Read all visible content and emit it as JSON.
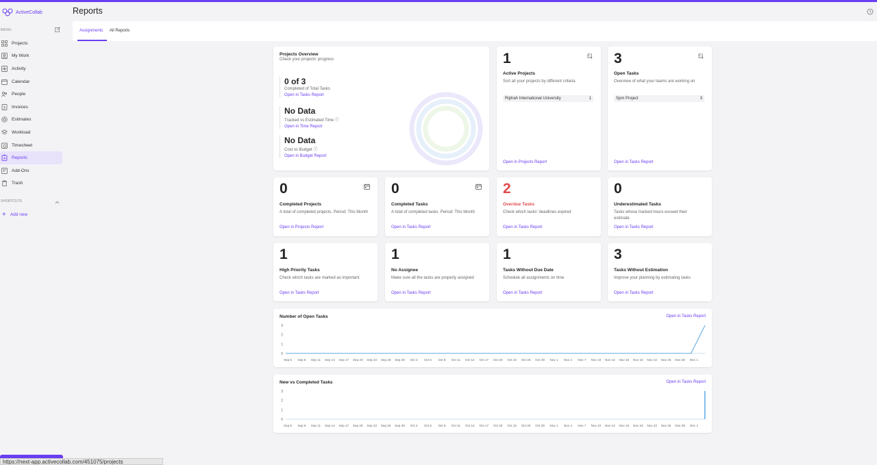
{
  "app": {
    "brand": "ActiveCollab",
    "page_title": "Reports",
    "status_url": "https://next-app.activecollab.com/451075/projects"
  },
  "sidebar": {
    "menu_label": "MENU",
    "items": [
      {
        "label": "Projects",
        "icon": "grid-icon"
      },
      {
        "label": "My Work",
        "icon": "user-square-icon"
      },
      {
        "label": "Activity",
        "icon": "activity-icon"
      },
      {
        "label": "Calendar",
        "icon": "calendar-icon"
      },
      {
        "label": "People",
        "icon": "people-icon"
      },
      {
        "label": "Invoices",
        "icon": "invoice-icon"
      },
      {
        "label": "Estimates",
        "icon": "estimate-icon"
      },
      {
        "label": "Workload",
        "icon": "workload-icon"
      },
      {
        "label": "Timesheet",
        "icon": "timesheet-icon"
      },
      {
        "label": "Reports",
        "icon": "reports-icon"
      },
      {
        "label": "Add-Ons",
        "icon": "addons-icon"
      },
      {
        "label": "Trash",
        "icon": "trash-icon"
      }
    ],
    "shortcuts_label": "SHORTCUTS",
    "add_new": "Add new"
  },
  "tabs": [
    {
      "label": "Assignments"
    },
    {
      "label": "All Reports"
    }
  ],
  "overview": {
    "title": "Projects Overview",
    "subtitle": "Check your projects' progress",
    "stats": [
      {
        "value": "0 of 3",
        "label": "Completed of Total Tasks",
        "link": "Open in Tasks Report"
      },
      {
        "value": "No Data",
        "label": "Tracked vs Estimated Time",
        "link": "Open in Time Report"
      },
      {
        "value": "No Data",
        "label": "Cost vs Budget",
        "link": "Open in Budget Report"
      }
    ]
  },
  "active_projects": {
    "value": "1",
    "title": "Active Projects",
    "desc": "Sort all your projects by different criteria",
    "row_name": "Riphah International University",
    "row_count": "1",
    "link": "Open in Projects Report"
  },
  "open_tasks": {
    "value": "3",
    "title": "Open Tasks",
    "desc": "Overview of what your teams are working on",
    "row_name": "Spm Project",
    "row_count": "3",
    "link": "Open in Tasks Report"
  },
  "cards_row2": [
    {
      "value": "0",
      "title": "Completed Projects",
      "desc": "A total of completed projects. Period: This Month",
      "link": "Open in Projects Report"
    },
    {
      "value": "0",
      "title": "Completed Tasks",
      "desc": "A total of completed tasks. Period: This Month",
      "link": "Open in Tasks Report"
    },
    {
      "value": "2",
      "title": "Overdue Tasks",
      "desc": "Check which tasks' deadlines expired",
      "link": "Open in Tasks Report"
    },
    {
      "value": "0",
      "title": "Underestimated Tasks",
      "desc": "Tasks whose tracked hours exceed their estimate",
      "link": "Open in Tasks Report"
    }
  ],
  "cards_row3": [
    {
      "value": "1",
      "title": "High Priority Tasks",
      "desc": "Check which tasks are marked as important",
      "link": "Open in Tasks Report"
    },
    {
      "value": "1",
      "title": "No Assignee",
      "desc": "Make sure all the tasks are properly assigned",
      "link": "Open in Tasks Report"
    },
    {
      "value": "1",
      "title": "Tasks Without Due Date",
      "desc": "Schedule all assignments on time",
      "link": "Open in Tasks Report"
    },
    {
      "value": "3",
      "title": "Tasks Without Estimation",
      "desc": "Improve your planning by estimating tasks",
      "link": "Open in Tasks Report"
    }
  ],
  "colors": {
    "accent": "#6a3df2",
    "danger": "#e04a4a",
    "line": "#5aa9e6"
  },
  "chart_data": [
    {
      "type": "line",
      "title": "Number of Open Tasks",
      "link": "Open in Tasks Report",
      "x": [
        "Sep 5",
        "Sep 8",
        "Sep 11",
        "Sep 14",
        "Sep 17",
        "Sep 20",
        "Sep 23",
        "Sep 26",
        "Sep 29",
        "Oct 2",
        "Oct 5",
        "Oct 8",
        "Oct 11",
        "Oct 14",
        "Oct 17",
        "Oct 20",
        "Oct 23",
        "Oct 26",
        "Oct 29",
        "Nov 1",
        "Nov 4",
        "Nov 7",
        "Nov 10",
        "Nov 13",
        "Nov 16",
        "Nov 19",
        "Nov 22",
        "Nov 25",
        "Nov 28",
        "Dec 1"
      ],
      "yticks": [
        0,
        1,
        2,
        3
      ],
      "ylim": [
        0,
        3
      ],
      "values": [
        0,
        0,
        0,
        0,
        0,
        0,
        0,
        0,
        0,
        0,
        0,
        0,
        0,
        0,
        0,
        0,
        0,
        0,
        0,
        0,
        0,
        0,
        0,
        0,
        0,
        0,
        0,
        0,
        0,
        0,
        3
      ]
    },
    {
      "type": "bar",
      "title": "New vs Completed Tasks",
      "link": "Open in Tasks Report",
      "x": [
        "Sep 5",
        "Sep 8",
        "Sep 11",
        "Sep 14",
        "Sep 17",
        "Sep 20",
        "Sep 23",
        "Sep 26",
        "Sep 29",
        "Oct 2",
        "Oct 5",
        "Oct 8",
        "Oct 11",
        "Oct 14",
        "Oct 17",
        "Oct 20",
        "Oct 23",
        "Oct 26",
        "Oct 29",
        "Nov 1",
        "Nov 4",
        "Nov 7",
        "Nov 10",
        "Nov 13",
        "Nov 16",
        "Nov 19",
        "Nov 22",
        "Nov 25",
        "Nov 28",
        "Dec 1"
      ],
      "yticks": [
        0,
        1,
        2,
        3
      ],
      "ylim": [
        0,
        3
      ],
      "values": [
        0,
        0,
        0,
        0,
        0,
        0,
        0,
        0,
        0,
        0,
        0,
        0,
        0,
        0,
        0,
        0,
        0,
        0,
        0,
        0,
        0,
        0,
        0,
        0,
        0,
        0,
        0,
        0,
        0,
        0,
        3
      ]
    }
  ]
}
